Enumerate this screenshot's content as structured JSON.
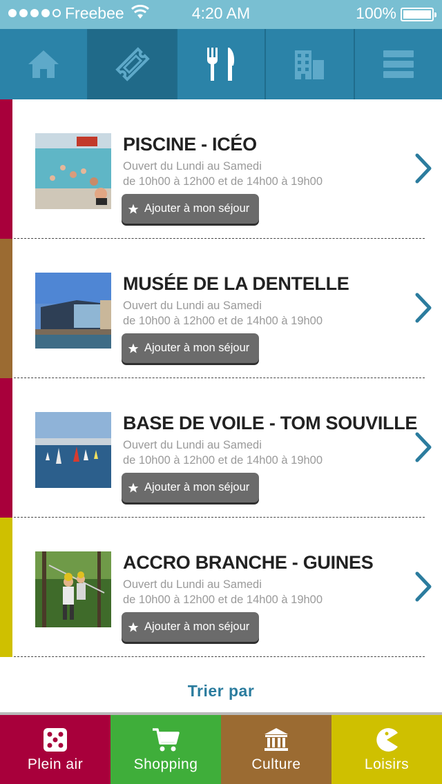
{
  "status_bar": {
    "carrier": "Freebee",
    "time": "4:20 AM",
    "battery": "100%"
  },
  "nav_tabs": [
    {
      "icon": "home-icon",
      "active": false
    },
    {
      "icon": "ticket-icon",
      "active": true
    },
    {
      "icon": "fork-knife-icon",
      "active": false
    },
    {
      "icon": "building-icon",
      "active": false
    },
    {
      "icon": "menu-icon",
      "active": false
    }
  ],
  "items": [
    {
      "title": "PISCINE - ICÉO",
      "hours_line1": "Ouvert du Lundi au Samedi",
      "hours_line2": "de 10h00 à 12h00 et de 14h00 à 19h00",
      "button": "Ajouter à mon séjour",
      "stripe_color": "#a8003b"
    },
    {
      "title": "MUSÉE DE LA DENTELLE",
      "hours_line1": "Ouvert du Lundi au Samedi",
      "hours_line2": "de 10h00 à 12h00 et de 14h00 à 19h00",
      "button": "Ajouter à mon séjour",
      "stripe_color": "#9b6b32"
    },
    {
      "title": "BASE DE VOILE - TOM SOUVILLE",
      "hours_line1": "Ouvert du Lundi au Samedi",
      "hours_line2": "de 10h00 à 12h00 et de 14h00 à 19h00",
      "button": "Ajouter à mon séjour",
      "stripe_color": "#a8003b"
    },
    {
      "title": "ACCRO BRANCHE - GUINES",
      "hours_line1": "Ouvert du Lundi au Samedi",
      "hours_line2": "de 10h00 à 12h00 et de 14h00 à 19h00",
      "button": "Ajouter à mon séjour",
      "stripe_color": "#cfc000"
    }
  ],
  "sort_label": "Trier par",
  "categories": [
    {
      "label": "Plein air",
      "icon": "dice-icon",
      "color": "#a8003b"
    },
    {
      "label": "Shopping",
      "icon": "cart-icon",
      "color": "#3fae3a"
    },
    {
      "label": "Culture",
      "icon": "museum-icon",
      "color": "#9b6b32"
    },
    {
      "label": "Loisirs",
      "icon": "pacman-icon",
      "color": "#cfc000"
    }
  ],
  "colors": {
    "status_bar": "#79bfd2",
    "nav_bar": "#2b83a8",
    "nav_active": "#206a89",
    "link": "#2b7c9e"
  }
}
